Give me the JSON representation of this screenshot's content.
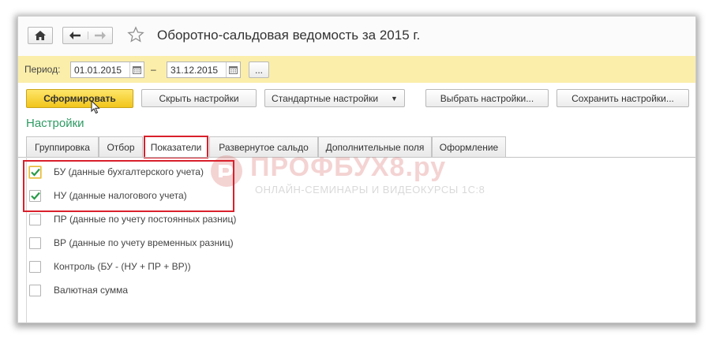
{
  "window": {
    "title": "Оборотно-сальдовая ведомость за 2015 г."
  },
  "period": {
    "label": "Период:",
    "from": "01.01.2015",
    "separator": "–",
    "to": "31.12.2015",
    "more_label": "..."
  },
  "toolbar": {
    "generate_label": "Сформировать",
    "hide_settings_label": "Скрыть настройки",
    "standard_settings_label": "Стандартные настройки",
    "choose_settings_label": "Выбрать настройки...",
    "save_settings_label": "Сохранить настройки..."
  },
  "settings": {
    "title": "Настройки",
    "tabs": [
      {
        "label": "Группировка",
        "active": false
      },
      {
        "label": "Отбор",
        "active": false
      },
      {
        "label": "Показатели",
        "active": true
      },
      {
        "label": "Развернутое сальдо",
        "active": false
      },
      {
        "label": "Дополнительные поля",
        "active": false
      },
      {
        "label": "Оформление",
        "active": false
      }
    ],
    "indicators": [
      {
        "label": "БУ (данные бухгалтерского учета)",
        "checked": true
      },
      {
        "label": "НУ (данные налогового учета)",
        "checked": true
      },
      {
        "label": "ПР (данные по учету постоянных разниц)",
        "checked": false
      },
      {
        "label": "ВР (данные по учету временных разниц)",
        "checked": false
      },
      {
        "label": "Контроль (БУ - (НУ + ПР + ВР))",
        "checked": false
      },
      {
        "label": "Валютная сумма",
        "checked": false
      }
    ]
  },
  "watermark": {
    "brand": "ПРОФБУХ8.ру",
    "tagline": "ОНЛАЙН-СЕМИНАРЫ И ВИДЕОКУРСЫ 1С:8"
  },
  "colors": {
    "accent_green": "#2e9b63",
    "period_bar": "#fbeeaa",
    "generate_button": "#f1c51b",
    "highlight_red": "#d9202c",
    "check_green": "#2a9a4a"
  },
  "icons": {
    "home": "home-icon",
    "back": "arrow-left-icon",
    "forward": "arrow-right-icon",
    "favorite": "star-icon",
    "calendar": "calendar-icon",
    "dropdown": "chevron-down-icon",
    "check": "checkmark-icon"
  }
}
